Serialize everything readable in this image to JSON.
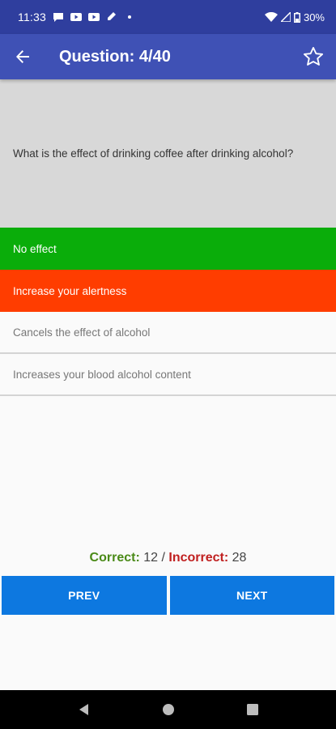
{
  "status_bar": {
    "time": "11:33",
    "battery": "30%",
    "icons": [
      "chat-icon",
      "youtube-icon",
      "youtube-icon",
      "pen-icon",
      "dot-icon",
      "wifi-icon",
      "signal-icon",
      "battery-icon"
    ]
  },
  "app_bar": {
    "title": "Question: 4/40",
    "back_icon": "arrow-left-icon",
    "favorite_icon": "star-outline-icon"
  },
  "question": {
    "text": "What is the effect of drinking coffee after drinking alcohol?"
  },
  "answers": [
    {
      "label": "No effect",
      "state": "correct"
    },
    {
      "label": "Increase your alertness",
      "state": "wrong"
    },
    {
      "label": "Cancels the effect of alcohol",
      "state": "neutral"
    },
    {
      "label": "Increases your blood alcohol content",
      "state": "neutral"
    }
  ],
  "score": {
    "correct_label": "Correct:",
    "correct_value": "12",
    "separator": "/",
    "incorrect_label": "Incorrect:",
    "incorrect_value": "28"
  },
  "buttons": {
    "prev": "PREV",
    "next": "NEXT"
  },
  "colors": {
    "app_bar": "#3f51b5",
    "status_bar": "#2f3e9e",
    "correct": "#0aad0a",
    "wrong": "#ff3d00",
    "button": "#0d78e0"
  }
}
